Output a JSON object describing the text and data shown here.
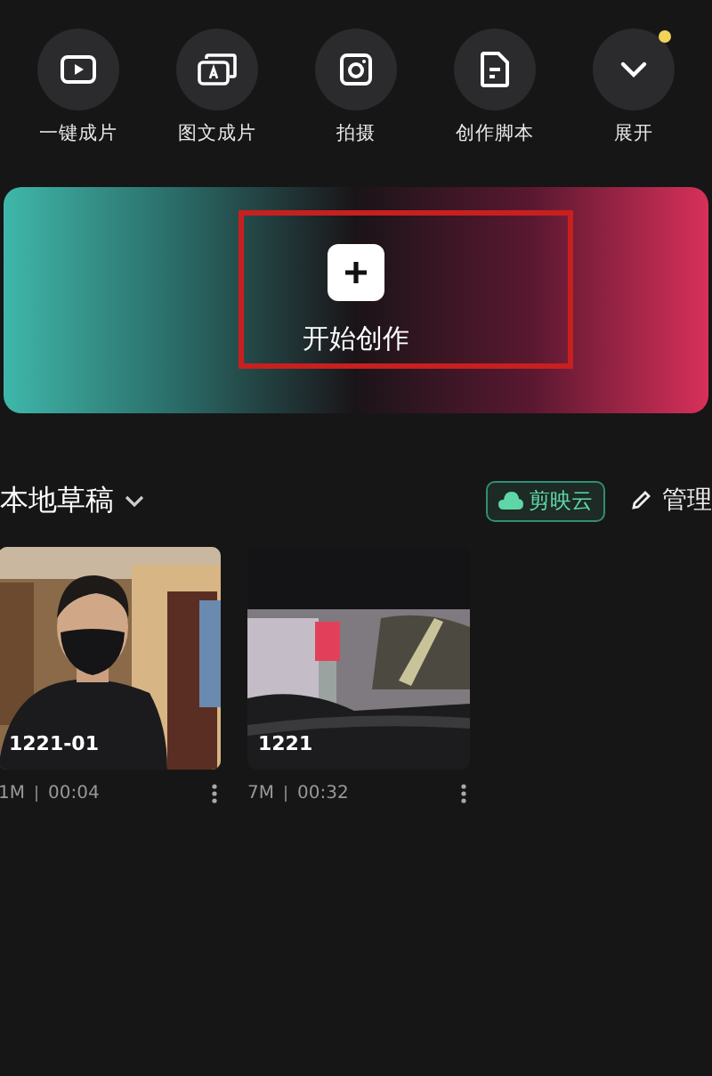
{
  "tools": [
    {
      "label": "一键成片",
      "badge": false
    },
    {
      "label": "图文成片",
      "badge": false
    },
    {
      "label": "拍摄",
      "badge": false
    },
    {
      "label": "创作脚本",
      "badge": false
    },
    {
      "label": "展开",
      "badge": true
    }
  ],
  "create": {
    "label": "开始创作"
  },
  "drafts": {
    "title": "本地草稿",
    "cloud": "剪映云",
    "manage": "管理",
    "items": [
      {
        "name": "1221-01",
        "size": "1M",
        "duration": "00:04"
      },
      {
        "name": "1221",
        "size": "7M",
        "duration": "00:32"
      }
    ]
  }
}
